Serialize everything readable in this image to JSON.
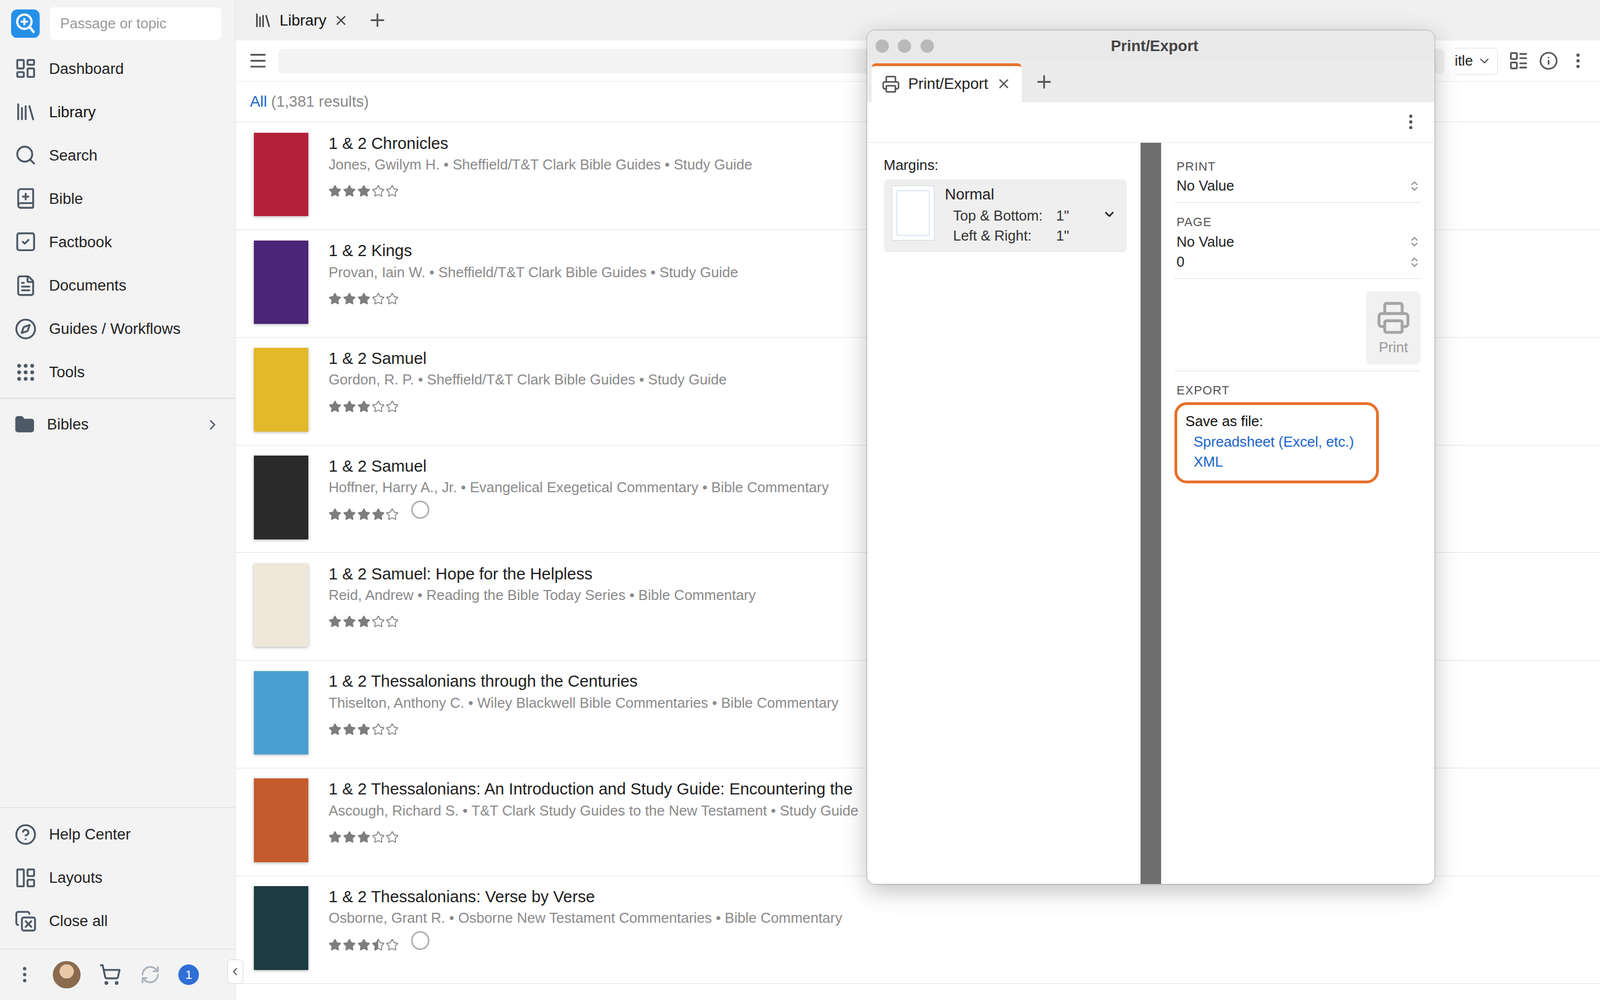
{
  "sidebar": {
    "search_placeholder": "Passage or topic",
    "items": [
      {
        "label": "Dashboard",
        "selected": false
      },
      {
        "label": "Library",
        "selected": true
      },
      {
        "label": "Search",
        "selected": false
      },
      {
        "label": "Bible",
        "selected": false
      },
      {
        "label": "Factbook",
        "selected": false
      },
      {
        "label": "Documents",
        "selected": false
      },
      {
        "label": "Guides / Workflows",
        "selected": false
      },
      {
        "label": "Tools",
        "selected": false
      }
    ],
    "folders": [
      {
        "label": "Bibles",
        "expanded": false
      }
    ],
    "footer_items": [
      {
        "label": "Help Center"
      },
      {
        "label": "Layouts"
      },
      {
        "label": "Close all"
      }
    ],
    "notification_count": "1"
  },
  "tabs": [
    {
      "label": "Library",
      "selected": true
    }
  ],
  "toolbar": {
    "sort_label": "itle"
  },
  "results": {
    "filter": "All",
    "count": "(1,381 results)"
  },
  "books": [
    {
      "title": "1 & 2 Chronicles",
      "meta": "Jones, Gwilym H. • Sheffield/T&T Clark Bible Guides • Study Guide",
      "stars": 3,
      "in_progress": false,
      "color": "#b3213b"
    },
    {
      "title": "1 & 2 Kings",
      "meta": "Provan, Iain W. • Sheffield/T&T Clark Bible Guides • Study Guide",
      "stars": 3,
      "in_progress": false,
      "color": "#4b2577"
    },
    {
      "title": "1 & 2 Samuel",
      "meta": "Gordon, R. P. • Sheffield/T&T Clark Bible Guides • Study Guide",
      "stars": 3,
      "in_progress": false,
      "color": "#e4b82b"
    },
    {
      "title": "1 & 2 Samuel",
      "meta": "Hoffner, Harry A., Jr. • Evangelical Exegetical Commentary • Bible Commentary",
      "stars": 4,
      "in_progress": true,
      "color": "#2a2a2a"
    },
    {
      "title": "1 & 2 Samuel: Hope for the Helpless",
      "meta": "Reid, Andrew • Reading the Bible Today Series • Bible Commentary",
      "stars": 3,
      "in_progress": false,
      "color": "#efe7da"
    },
    {
      "title": "1 & 2 Thessalonians through the Centuries",
      "meta": "Thiselton, Anthony C. • Wiley Blackwell Bible Commentaries • Bible Commentary",
      "stars": 3,
      "in_progress": false,
      "color": "#4a9fd2"
    },
    {
      "title": "1 & 2 Thessalonians: An Introduction and Study Guide: Encountering the",
      "meta": "Ascough, Richard S. • T&T Clark Study Guides to the New Testament • Study Guide",
      "stars": 3,
      "in_progress": false,
      "color": "#c45b2c"
    },
    {
      "title": "1 & 2 Thessalonians: Verse by Verse",
      "meta": "Osborne, Grant R. • Osborne New Testament Commentaries • Bible Commentary",
      "stars": 3.5,
      "in_progress": true,
      "color": "#1f3b42"
    }
  ],
  "print_window": {
    "title": "Print/Export",
    "tabs": [
      {
        "label": "Print/Export",
        "selected": true
      }
    ],
    "margins": {
      "label": "Margins:",
      "preset": "Normal",
      "rows": [
        {
          "label": "Top & Bottom:",
          "value": "1\""
        },
        {
          "label": "Left & Right:",
          "value": "1\""
        }
      ]
    },
    "print": {
      "label": "PRINT",
      "value": "No Value"
    },
    "page": {
      "label": "PAGE",
      "value": "No Value",
      "number": "0"
    },
    "print_button": {
      "label": "Print",
      "disabled": true
    },
    "export": {
      "label": "EXPORT",
      "heading": "Save as file:",
      "highlighted": true,
      "links": [
        "Spreadsheet (Excel, etc.)",
        "XML"
      ]
    }
  }
}
